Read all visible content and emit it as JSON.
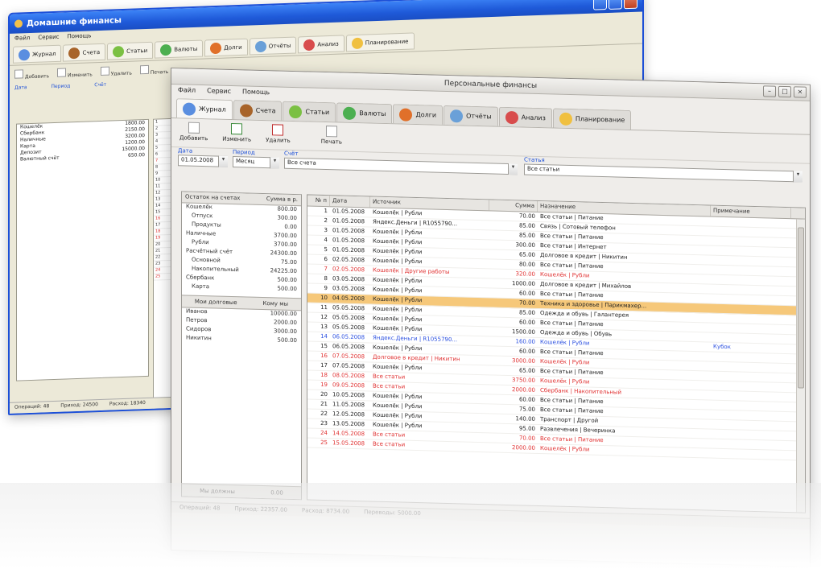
{
  "colors": {
    "xp_blue": "#1c4fd8",
    "selection": "#f6c87a",
    "text_red": "#e03030",
    "text_blue": "#2a4fe0",
    "link_blue": "#1c4fd8"
  },
  "back_window": {
    "title": "Домашние финансы",
    "menu": [
      "Файл",
      "Сервис",
      "Помощь"
    ],
    "tabs": [
      {
        "label": "Журнал",
        "icon": "journal-icon"
      },
      {
        "label": "Счета",
        "icon": "wallet-icon"
      },
      {
        "label": "Статьи",
        "icon": "clouds-icon"
      },
      {
        "label": "Валюты",
        "icon": "currency-icon"
      },
      {
        "label": "Долги",
        "icon": "debt-icon"
      },
      {
        "label": "Отчёты",
        "icon": "report-icon"
      },
      {
        "label": "Анализ",
        "icon": "chart-icon"
      },
      {
        "label": "Планирование",
        "icon": "planning-icon"
      }
    ],
    "toolbar": [
      "Добавить",
      "Изменить",
      "Удалить",
      "Печать"
    ],
    "filters": [
      "Дата",
      "Период",
      "Счёт"
    ],
    "left_rows": [
      {
        "name": "Кошелёк",
        "value": "1800.00"
      },
      {
        "name": "Сбербанк",
        "value": "2150.00"
      },
      {
        "name": "Наличные",
        "value": "3200.00"
      },
      {
        "name": "Карта",
        "value": "1200.00"
      },
      {
        "name": "Депозит",
        "value": "15000.00"
      },
      {
        "name": "Валютный счёт",
        "value": "650.00"
      }
    ],
    "status": [
      "Операций: 48",
      "Приход: 24500",
      "Расход: 18340"
    ]
  },
  "front_window": {
    "title": "Персональные финансы",
    "menu": [
      "Файл",
      "Сервис",
      "Помощь"
    ],
    "tabs": [
      {
        "label": "Журнал",
        "icon": "journal-icon"
      },
      {
        "label": "Счета",
        "icon": "wallet-icon"
      },
      {
        "label": "Статьи",
        "icon": "clouds-icon"
      },
      {
        "label": "Валюты",
        "icon": "currency-icon"
      },
      {
        "label": "Долги",
        "icon": "debt-icon"
      },
      {
        "label": "Отчёты",
        "icon": "report-icon"
      },
      {
        "label": "Анализ",
        "icon": "chart-icon"
      },
      {
        "label": "Планирование",
        "icon": "planning-icon"
      }
    ],
    "toolbar": [
      "Добавить",
      "Изменить",
      "Удалить",
      "Печать"
    ],
    "filters": {
      "date_label": "Дата",
      "date_value": "01.05.2008",
      "period_label": "Период",
      "period_value": "Месяц",
      "account_label": "Счёт",
      "account_value": "Все счета",
      "article_label": "Статья",
      "article_value": "Все статьи"
    },
    "left_panel": {
      "header": [
        "Остаток на счетах",
        "Сумма в р."
      ],
      "rows": [
        {
          "name": "Кошелёк",
          "value": "800.00",
          "indent": false
        },
        {
          "name": "Отпуск",
          "value": "300.00",
          "indent": true
        },
        {
          "name": "Продукты",
          "value": "0.00",
          "indent": true
        },
        {
          "name": "Наличные",
          "value": "3700.00",
          "indent": false
        },
        {
          "name": "Рубли",
          "value": "3700.00",
          "indent": true
        },
        {
          "name": "Расчётный счёт",
          "value": "24300.00",
          "indent": false
        },
        {
          "name": "Основной",
          "value": "75.00",
          "indent": true
        },
        {
          "name": "Накопительный",
          "value": "24225.00",
          "indent": true
        },
        {
          "name": "Сбербанк",
          "value": "500.00",
          "indent": false
        },
        {
          "name": "Карта",
          "value": "500.00",
          "indent": true
        }
      ],
      "split": [
        "Мои долговые",
        "Кому мы"
      ],
      "debts": [
        {
          "name": "Иванов",
          "value": "10000.00"
        },
        {
          "name": "Петров",
          "value": "2000.00"
        },
        {
          "name": "Сидоров",
          "value": "3000.00"
        },
        {
          "name": "Никитин",
          "value": "500.00"
        }
      ],
      "footer": [
        "Мы должны",
        "0.00"
      ]
    },
    "grid": {
      "columns": [
        "№ п",
        "Дата",
        "Источник",
        "Сумма",
        "Назначение",
        "Примечание"
      ],
      "rows": [
        {
          "n": "1",
          "date": "01.05.2008",
          "source": "Кошелёк | Рубли",
          "sum": "70.00",
          "dest": "Все статьи | Питание",
          "note": "",
          "color": "normal",
          "selected": false
        },
        {
          "n": "2",
          "date": "01.05.2008",
          "source": "Яндекс.Деньги | R1055790...",
          "sum": "85.00",
          "dest": "Связь | Сотовый телефон",
          "note": "",
          "color": "normal",
          "selected": false
        },
        {
          "n": "3",
          "date": "01.05.2008",
          "source": "Кошелёк | Рубли",
          "sum": "85.00",
          "dest": "Все статьи | Питание",
          "note": "",
          "color": "normal",
          "selected": false
        },
        {
          "n": "4",
          "date": "01.05.2008",
          "source": "Кошелёк | Рубли",
          "sum": "300.00",
          "dest": "Все статьи | Интернет",
          "note": "",
          "color": "normal",
          "selected": false
        },
        {
          "n": "5",
          "date": "01.05.2008",
          "source": "Кошелёк | Рубли",
          "sum": "65.00",
          "dest": "Долговое в кредит | Никитин",
          "note": "",
          "color": "normal",
          "selected": false
        },
        {
          "n": "6",
          "date": "02.05.2008",
          "source": "Кошелёк | Рубли",
          "sum": "80.00",
          "dest": "Все статьи | Питание",
          "note": "",
          "color": "normal",
          "selected": false
        },
        {
          "n": "7",
          "date": "02.05.2008",
          "source": "Кошелёк | Другие работы",
          "sum": "320.00",
          "dest": "Кошелёк | Рубли",
          "note": "",
          "color": "red",
          "selected": false
        },
        {
          "n": "8",
          "date": "03.05.2008",
          "source": "Кошелёк | Рубли",
          "sum": "1000.00",
          "dest": "Долговое в кредит | Михайлов",
          "note": "",
          "color": "normal",
          "selected": false
        },
        {
          "n": "9",
          "date": "03.05.2008",
          "source": "Кошелёк | Рубли",
          "sum": "60.00",
          "dest": "Все статьи | Питание",
          "note": "",
          "color": "normal",
          "selected": false
        },
        {
          "n": "10",
          "date": "04.05.2008",
          "source": "Кошелёк | Рубли",
          "sum": "70.00",
          "dest": "Техника и здоровье | Парикмахер...",
          "note": "",
          "color": "normal",
          "selected": true
        },
        {
          "n": "11",
          "date": "05.05.2008",
          "source": "Кошелёк | Рубли",
          "sum": "85.00",
          "dest": "Одежда и обувь | Галантерея",
          "note": "",
          "color": "normal",
          "selected": false
        },
        {
          "n": "12",
          "date": "05.05.2008",
          "source": "Кошелёк | Рубли",
          "sum": "60.00",
          "dest": "Все статьи | Питание",
          "note": "",
          "color": "normal",
          "selected": false
        },
        {
          "n": "13",
          "date": "05.05.2008",
          "source": "Кошелёк | Рубли",
          "sum": "1500.00",
          "dest": "Одежда и обувь | Обувь",
          "note": "",
          "color": "normal",
          "selected": false
        },
        {
          "n": "14",
          "date": "06.05.2008",
          "source": "Яндекс.Деньги | R1055790...",
          "sum": "160.00",
          "dest": "Кошелёк | Рубли",
          "note": "Кубок",
          "color": "blue",
          "selected": false
        },
        {
          "n": "15",
          "date": "06.05.2008",
          "source": "Кошелёк | Рубли",
          "sum": "60.00",
          "dest": "Все статьи | Питание",
          "note": "",
          "color": "normal",
          "selected": false
        },
        {
          "n": "16",
          "date": "07.05.2008",
          "source": "Долговое в кредит | Никитин",
          "sum": "3000.00",
          "dest": "Кошелёк | Рубли",
          "note": "",
          "color": "red",
          "selected": false
        },
        {
          "n": "17",
          "date": "07.05.2008",
          "source": "Кошелёк | Рубли",
          "sum": "65.00",
          "dest": "Все статьи | Питание",
          "note": "",
          "color": "normal",
          "selected": false
        },
        {
          "n": "18",
          "date": "08.05.2008",
          "source": "Все статьи",
          "sum": "3750.00",
          "dest": "Кошелёк | Рубли",
          "note": "",
          "color": "red",
          "selected": false
        },
        {
          "n": "19",
          "date": "09.05.2008",
          "source": "Все статьи",
          "sum": "2000.00",
          "dest": "Сбербанк | Накопительный",
          "note": "",
          "color": "red",
          "selected": false
        },
        {
          "n": "20",
          "date": "10.05.2008",
          "source": "Кошелёк | Рубли",
          "sum": "60.00",
          "dest": "Все статьи | Питание",
          "note": "",
          "color": "normal",
          "selected": false
        },
        {
          "n": "21",
          "date": "11.05.2008",
          "source": "Кошелёк | Рубли",
          "sum": "75.00",
          "dest": "Все статьи | Питание",
          "note": "",
          "color": "normal",
          "selected": false
        },
        {
          "n": "22",
          "date": "12.05.2008",
          "source": "Кошелёк | Рубли",
          "sum": "140.00",
          "dest": "Транспорт | Другой",
          "note": "",
          "color": "normal",
          "selected": false
        },
        {
          "n": "23",
          "date": "13.05.2008",
          "source": "Кошелёк | Рубли",
          "sum": "95.00",
          "dest": "Развлечения | Вечеринка",
          "note": "",
          "color": "normal",
          "selected": false
        },
        {
          "n": "24",
          "date": "14.05.2008",
          "source": "Все статьи",
          "sum": "70.00",
          "dest": "Все статьи | Питание",
          "note": "",
          "color": "red",
          "selected": false
        },
        {
          "n": "25",
          "date": "15.05.2008",
          "source": "Все статьи",
          "sum": "2000.00",
          "dest": "Кошелёк | Рубли",
          "note": "",
          "color": "red",
          "selected": false
        }
      ]
    },
    "status": [
      "Операций: 48",
      "Приход: 22357.00",
      "Расход: 8734.00",
      "Переводы: 5000.00"
    ]
  }
}
